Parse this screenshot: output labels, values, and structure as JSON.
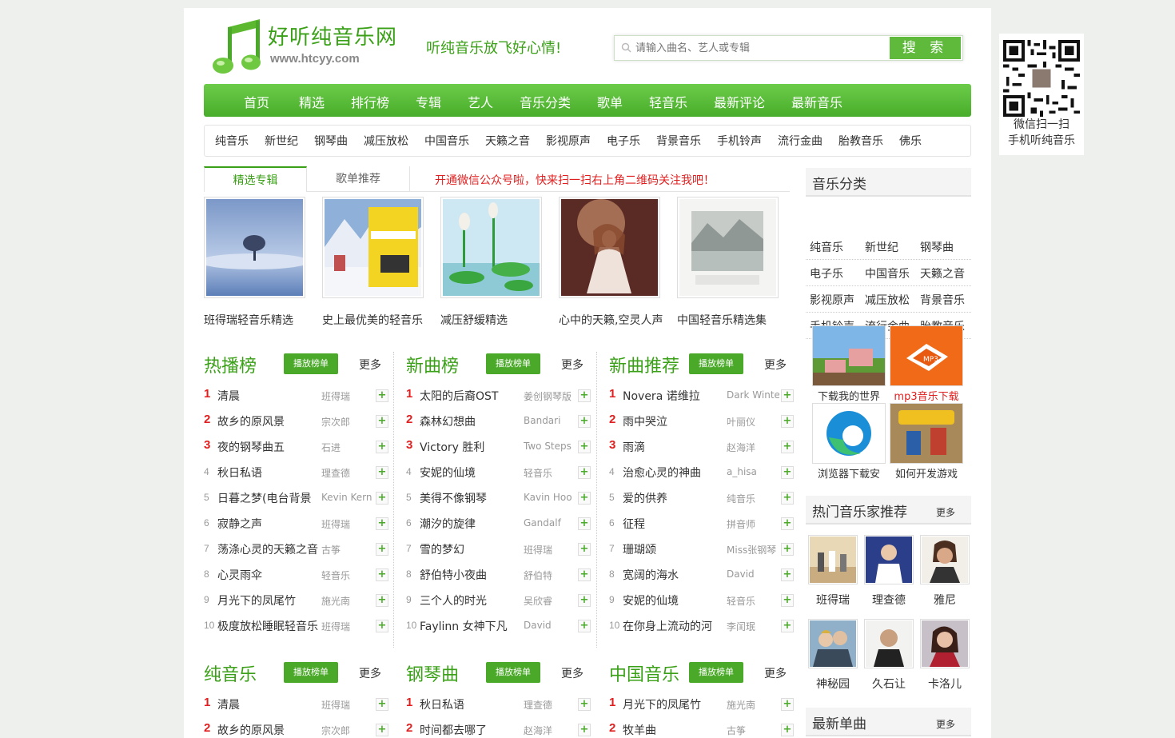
{
  "header": {
    "site_name": "好听纯音乐网",
    "site_domain": "www.htcyy.com",
    "slogan": "听纯音乐放飞好心情!",
    "search_placeholder": "请输入曲名、艺人或专辑",
    "search_button": "搜 索"
  },
  "nav": [
    "首页",
    "精选",
    "排行榜",
    "专辑",
    "艺人",
    "音乐分类",
    "歌单",
    "轻音乐",
    "最新评论",
    "最新音乐"
  ],
  "subnav": [
    "纯音乐",
    "新世纪",
    "钢琴曲",
    "减压放松",
    "中国音乐",
    "天籁之音",
    "影视原声",
    "电子乐",
    "背景音乐",
    "手机铃声",
    "流行金曲",
    "胎教音乐",
    "佛乐"
  ],
  "tabs": {
    "active": "精选专辑",
    "other": "歌单推荐",
    "notice": "开通微信公众号啦，快来扫一扫右上角二维码关注我吧！"
  },
  "albums": [
    "班得瑞轻音乐精选",
    "史上最优美的轻音乐",
    "减压舒缓精选",
    "心中的天籁,空灵人声",
    "中国轻音乐精选集"
  ],
  "panels": [
    {
      "title": "热播榜",
      "button": "播放榜单",
      "more": "更多",
      "rows": [
        [
          "1",
          "清晨",
          "班得瑞"
        ],
        [
          "2",
          "故乡的原风景",
          "宗次郎"
        ],
        [
          "3",
          "夜的钢琴曲五",
          "石进"
        ],
        [
          "4",
          "秋日私语",
          "理查德"
        ],
        [
          "5",
          "日暮之梦(电台背景",
          "Kevin Kern"
        ],
        [
          "6",
          "寂静之声",
          "班得瑞"
        ],
        [
          "7",
          "荡涤心灵的天籁之音",
          "古筝"
        ],
        [
          "8",
          "心灵雨伞",
          "轻音乐"
        ],
        [
          "9",
          "月光下的凤尾竹",
          "施光南"
        ],
        [
          "10",
          "极度放松睡眠轻音乐",
          "班得瑞"
        ]
      ]
    },
    {
      "title": "新曲榜",
      "button": "播放榜单",
      "more": "更多",
      "rows": [
        [
          "1",
          "太阳的后裔OST",
          "姜创钢琴版"
        ],
        [
          "2",
          "森林幻想曲",
          "Bandari"
        ],
        [
          "3",
          "Victory 胜利",
          "Two Steps"
        ],
        [
          "4",
          "安妮的仙境",
          "轻音乐"
        ],
        [
          "5",
          "美得不像钢琴",
          "Kavin Hoo"
        ],
        [
          "6",
          "潮汐的旋律",
          "Gandalf"
        ],
        [
          "7",
          "雪的梦幻",
          "班得瑞"
        ],
        [
          "8",
          "舒伯特小夜曲",
          "舒伯特"
        ],
        [
          "9",
          "三个人的时光",
          "吴欣睿"
        ],
        [
          "10",
          "Faylinn 女神下凡",
          "David"
        ]
      ]
    },
    {
      "title": "新曲推荐",
      "button": "播放榜单",
      "more": "更多",
      "rows": [
        [
          "1",
          "Novera 诺维拉",
          "Dark Winter"
        ],
        [
          "2",
          "雨中哭泣",
          "叶丽仪"
        ],
        [
          "3",
          "雨滴",
          "赵海洋"
        ],
        [
          "4",
          "治愈心灵的神曲",
          "a_hisa"
        ],
        [
          "5",
          "爱的供养",
          "纯音乐"
        ],
        [
          "6",
          "征程",
          "拼音师"
        ],
        [
          "7",
          "珊瑚颂",
          "Miss张钢琴"
        ],
        [
          "8",
          "宽阔的海水",
          "David"
        ],
        [
          "9",
          "安妮的仙境",
          "轻音乐"
        ],
        [
          "10",
          "在你身上流动的河",
          "李闰珉"
        ]
      ]
    },
    {
      "title": "纯音乐",
      "button": "播放榜单",
      "more": "更多",
      "rows": [
        [
          "1",
          "清晨",
          "班得瑞"
        ],
        [
          "2",
          "故乡的原风景",
          "宗次郎"
        ]
      ]
    },
    {
      "title": "钢琴曲",
      "button": "播放榜单",
      "more": "更多",
      "rows": [
        [
          "1",
          "秋日私语",
          "理查德"
        ],
        [
          "2",
          "时间都去哪了",
          "赵海洋"
        ]
      ]
    },
    {
      "title": "中国音乐",
      "button": "播放榜单",
      "more": "更多",
      "rows": [
        [
          "1",
          "月光下的凤尾竹",
          "施光南"
        ],
        [
          "2",
          "牧羊曲",
          "古筝"
        ]
      ]
    }
  ],
  "sidebar": {
    "categories_title": "音乐分类",
    "categories": [
      "纯音乐",
      "新世纪",
      "钢琴曲",
      "电子乐",
      "中国音乐",
      "天籁之音",
      "影视原声",
      "减压放松",
      "背景音乐",
      "手机铃声",
      "流行金曲",
      "胎教音乐"
    ],
    "games": [
      {
        "label": "下载我的世界",
        "color": "#333"
      },
      {
        "label": "mp3音乐下载",
        "color": "#e02020"
      },
      {
        "label": "浏览器下载安",
        "color": "#333"
      },
      {
        "label": "如何开发游戏",
        "color": "#333"
      }
    ],
    "artists_title": "热门音乐家推荐",
    "artists_more": "更多",
    "artists": [
      "班得瑞",
      "理查德",
      "雅尼",
      "神秘园",
      "久石让",
      "卡洛儿"
    ],
    "singles_title": "最新单曲",
    "singles_more": "更多"
  },
  "qr": {
    "line1": "微信扫一扫",
    "line2": "手机听纯音乐"
  },
  "colors": {
    "brand": "#3aa017",
    "nav": "#4aa928",
    "notice": "#e02020"
  }
}
